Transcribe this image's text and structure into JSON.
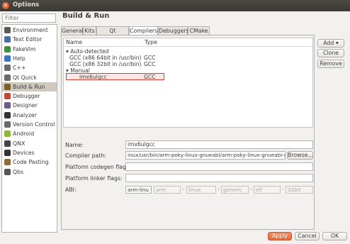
{
  "window": {
    "title": "Options"
  },
  "filter": {
    "placeholder": "Filter"
  },
  "sidebar": {
    "items": [
      {
        "label": "Environment",
        "icon": "environment-icon",
        "color": "#5a5a5a"
      },
      {
        "label": "Text Editor",
        "icon": "text-editor-icon",
        "color": "#4a6fa5"
      },
      {
        "label": "FakeVim",
        "icon": "fakevim-icon",
        "color": "#3f8f3f"
      },
      {
        "label": "Help",
        "icon": "help-icon",
        "color": "#3c74c2"
      },
      {
        "label": "C++",
        "icon": "cpp-icon",
        "color": "#6a6a6a"
      },
      {
        "label": "Qt Quick",
        "icon": "qt-quick-icon",
        "color": "#6a6a6a"
      },
      {
        "label": "Build & Run",
        "icon": "build-run-icon",
        "color": "#7a5e2c"
      },
      {
        "label": "Debugger",
        "icon": "debugger-icon",
        "color": "#c2463a"
      },
      {
        "label": "Designer",
        "icon": "designer-icon",
        "color": "#6f5a8c"
      },
      {
        "label": "Analyzer",
        "icon": "analyzer-icon",
        "color": "#333333"
      },
      {
        "label": "Version Control",
        "icon": "version-control-icon",
        "color": "#6a6a6a"
      },
      {
        "label": "Android",
        "icon": "android-icon",
        "color": "#8ab73c"
      },
      {
        "label": "QNX",
        "icon": "qnx-icon",
        "color": "#444444"
      },
      {
        "label": "Devices",
        "icon": "devices-icon",
        "color": "#333333"
      },
      {
        "label": "Code Pasting",
        "icon": "code-pasting-icon",
        "color": "#8a6d3b"
      },
      {
        "label": "Qbs",
        "icon": "qbs-icon",
        "color": "#555555"
      }
    ],
    "selected": "Build & Run"
  },
  "main": {
    "title": "Build & Run",
    "tabs": [
      "General",
      "Kits",
      "Qt Versions",
      "Compilers",
      "Debuggers",
      "CMake"
    ],
    "active_tab": "Compilers"
  },
  "tree": {
    "col_name": "Name",
    "col_type": "Type",
    "groups": [
      {
        "label": "Auto-detected",
        "rows": [
          {
            "name": "GCC (x86 64bit in /usr/bin)",
            "type": "GCC"
          },
          {
            "name": "GCC (x86 32bit in /usr/bin)",
            "type": "GCC"
          }
        ]
      },
      {
        "label": "Manual",
        "rows": [
          {
            "name": "imx6ulgcc",
            "type": "GCC"
          }
        ]
      }
    ]
  },
  "side_buttons": {
    "add": "Add",
    "clone": "Clone",
    "remove": "Remove"
  },
  "form": {
    "name_label": "Name:",
    "name_value": "imx6ulgcc",
    "path_label": "Compiler path:",
    "path_value": "inux/usr/bin/arm-poky-linux-gnueabi/arm-poky-linux-gnueabi-g++",
    "browse": "Browse...",
    "codegen_label": "Platform codegen flags:",
    "linker_label": "Platform linker flags:",
    "abi_label": "ABI:",
    "abi": [
      "arm-linu",
      "arm",
      "linux",
      "generic",
      "elf",
      "32bit"
    ]
  },
  "footer": {
    "apply": "Apply",
    "cancel": "Cancel",
    "ok": "OK"
  }
}
